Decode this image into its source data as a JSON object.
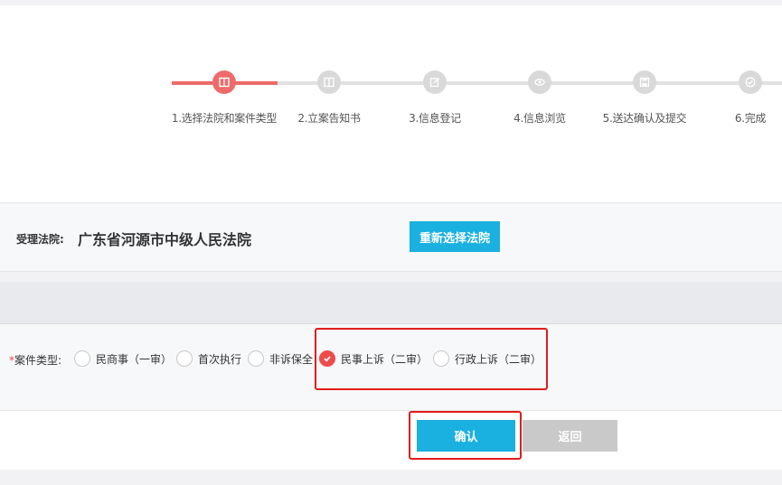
{
  "steps": [
    {
      "label": "1.选择法院和案件类型",
      "icon": "book-icon",
      "active": true
    },
    {
      "label": "2.立案告知书",
      "icon": "book-icon",
      "active": false
    },
    {
      "label": "3.信息登记",
      "icon": "edit-icon",
      "active": false
    },
    {
      "label": "4.信息浏览",
      "icon": "eye-icon",
      "active": false
    },
    {
      "label": "5.送达确认及提交",
      "icon": "save-icon",
      "active": false
    },
    {
      "label": "6.完成",
      "icon": "check-icon",
      "active": false
    }
  ],
  "court": {
    "label": "受理法院:",
    "name": "广东省河源市中级人民法院",
    "reselect_button": "重新选择法院"
  },
  "case_type": {
    "required_mark": "*",
    "label": "案件类型:",
    "options": [
      {
        "label": "民商事（一审）",
        "checked": false
      },
      {
        "label": "首次执行",
        "checked": false
      },
      {
        "label": "非诉保全",
        "checked": false
      },
      {
        "label": "民事上诉（二审）",
        "checked": true
      },
      {
        "label": "行政上诉（二审）",
        "checked": false
      }
    ]
  },
  "actions": {
    "confirm": "确认",
    "back": "返回"
  },
  "colors": {
    "step_active": "#ee6b6b",
    "step_inactive": "#d9d9d9",
    "primary_button": "#1ab0e0",
    "disabled_button": "#c9c9c9",
    "radio_checked": "#ee4b4b",
    "highlight": "#e21c1c"
  }
}
